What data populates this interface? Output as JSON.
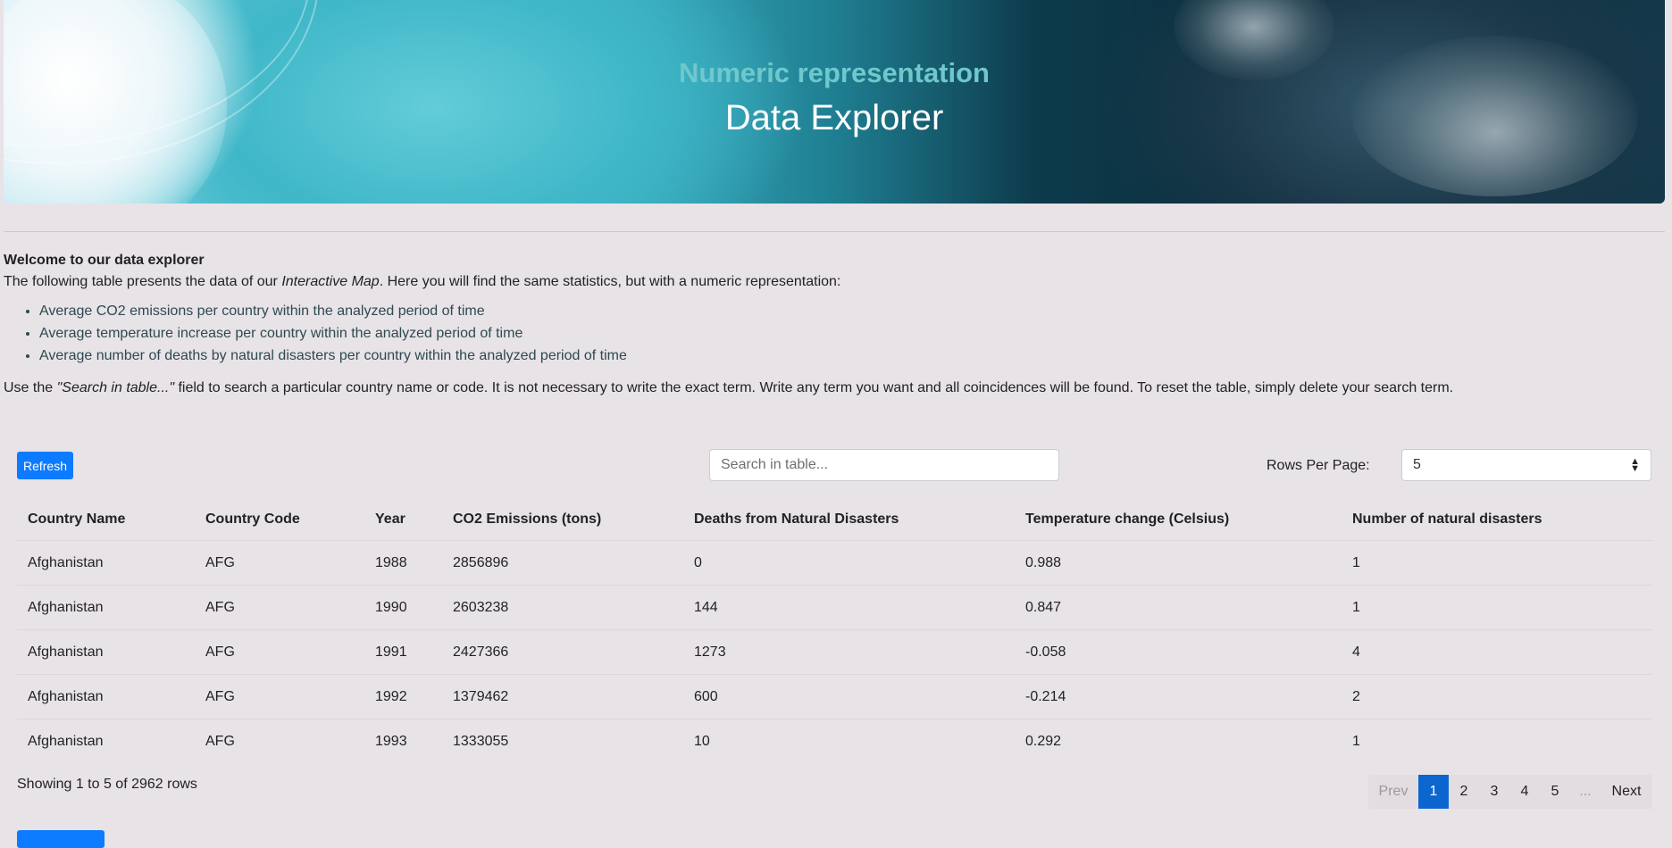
{
  "hero": {
    "subtitle": "Numeric representation",
    "title": "Data Explorer"
  },
  "intro": {
    "welcome": "Welcome to our data explorer",
    "line1_a": "The following table presents the data of our ",
    "line1_em": "Interactive Map",
    "line1_b": ". Here you will find the same statistics, but with a numeric representation:",
    "bullets": [
      "Average CO2 emissions per country within the analyzed period of time",
      "Average temperature increase per country within the analyzed period of time",
      "Average number of deaths by natural disasters per country within the analyzed period of time"
    ],
    "use_a": "Use the ",
    "use_em": "\"Search in table...\"",
    "use_b": " field to search a particular country name or code. It is not necessary to write the exact term. Write any term you want and all coincidences will be found. To reset the table, simply delete your search term."
  },
  "toolbar": {
    "refresh_label": "Refresh",
    "search_placeholder": "Search in table...",
    "rows_label": "Rows Per Page:",
    "rows_value": "5"
  },
  "table": {
    "headers": [
      "Country Name",
      "Country Code",
      "Year",
      "CO2 Emissions (tons)",
      "Deaths from Natural Disasters",
      "Temperature change (Celsius)",
      "Number of natural disasters"
    ],
    "rows": [
      [
        "Afghanistan",
        "AFG",
        "1988",
        "2856896",
        "0",
        "0.988",
        "1"
      ],
      [
        "Afghanistan",
        "AFG",
        "1990",
        "2603238",
        "144",
        "0.847",
        "1"
      ],
      [
        "Afghanistan",
        "AFG",
        "1991",
        "2427366",
        "1273",
        "-0.058",
        "4"
      ],
      [
        "Afghanistan",
        "AFG",
        "1992",
        "1379462",
        "600",
        "-0.214",
        "2"
      ],
      [
        "Afghanistan",
        "AFG",
        "1993",
        "1333055",
        "10",
        "0.292",
        "1"
      ]
    ]
  },
  "footer": {
    "showing": "Showing 1 to 5 of 2962 rows",
    "prev": "Prev",
    "pages": [
      "1",
      "2",
      "3",
      "4",
      "5"
    ],
    "ellipsis": "...",
    "next": "Next"
  },
  "colors": {
    "accent": "#0d7bff",
    "active_page": "#0b66d0",
    "background": "#e8e3e7"
  }
}
